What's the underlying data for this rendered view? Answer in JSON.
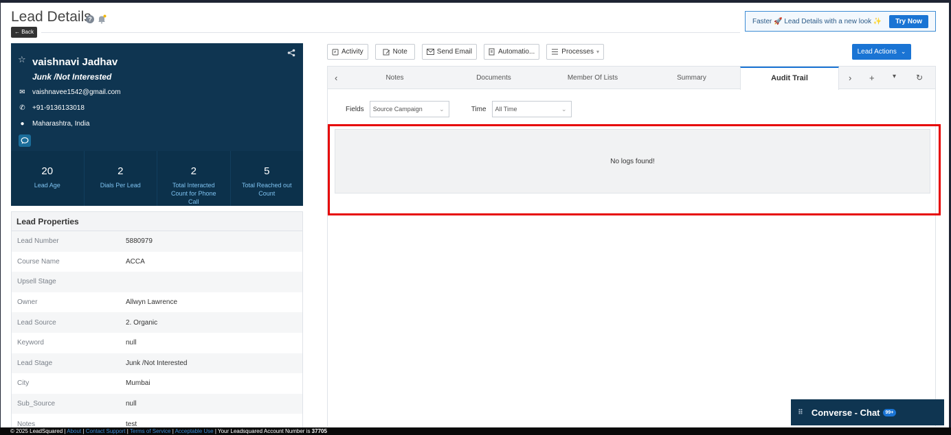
{
  "header": {
    "title": "Lead Details",
    "back_label": "← Back",
    "promo_text": "Faster 🚀 Lead Details with a new look ✨",
    "try_now": "Try Now"
  },
  "lead": {
    "name": "vaishnavi Jadhav",
    "stage": "Junk /Not Interested",
    "email": "vaishnavee1542@gmail.com",
    "phone": "+91-9136133018",
    "location": "Maharashtra, India"
  },
  "stats": [
    {
      "value": "20",
      "label": "Lead Age"
    },
    {
      "value": "2",
      "label": "Dials Per Lead"
    },
    {
      "value": "2",
      "label": "Total Interacted Count for Phone Call"
    },
    {
      "value": "5",
      "label": "Total Reached out Count"
    }
  ],
  "properties": {
    "title": "Lead Properties",
    "rows": [
      {
        "key": "Lead Number",
        "value": "5880979"
      },
      {
        "key": "Course Name",
        "value": "ACCA"
      },
      {
        "key": "Upsell Stage",
        "value": ""
      },
      {
        "key": "Owner",
        "value": "Allwyn Lawrence"
      },
      {
        "key": "Lead Source",
        "value": "2. Organic"
      },
      {
        "key": "Keyword",
        "value": "null"
      },
      {
        "key": "Lead Stage",
        "value": "Junk /Not Interested"
      },
      {
        "key": "City",
        "value": "Mumbai"
      },
      {
        "key": "Sub_Source",
        "value": "null"
      },
      {
        "key": "Notes",
        "value": "test"
      }
    ]
  },
  "toolbar": {
    "activity": "Activity",
    "note": "Note",
    "send_email": "Send Email",
    "automation": "Automatio...",
    "processes": "Processes",
    "lead_actions": "Lead Actions"
  },
  "tabs": {
    "notes": "Notes",
    "documents": "Documents",
    "member_of_lists": "Member Of Lists",
    "summary": "Summary",
    "audit_trail": "Audit Trail"
  },
  "filters": {
    "fields_label": "Fields",
    "fields_value": "Source Campaign",
    "time_label": "Time",
    "time_value": "All Time"
  },
  "logs": {
    "empty_text": "No logs found!"
  },
  "chat": {
    "label": "Converse - Chat",
    "badge": "99+"
  },
  "footer": {
    "copyright": "© 2025 LeadSquared | ",
    "about": "About",
    "contact": "Contact Support",
    "terms": "Terms of Service",
    "acceptable": "Acceptable Use",
    "account_text": " | Your Leadsquared Account Number is ",
    "account_number": "37705"
  },
  "colors": {
    "primary": "#1a74d4",
    "profile_bg": "#0f3551",
    "highlight": "#e60000"
  }
}
